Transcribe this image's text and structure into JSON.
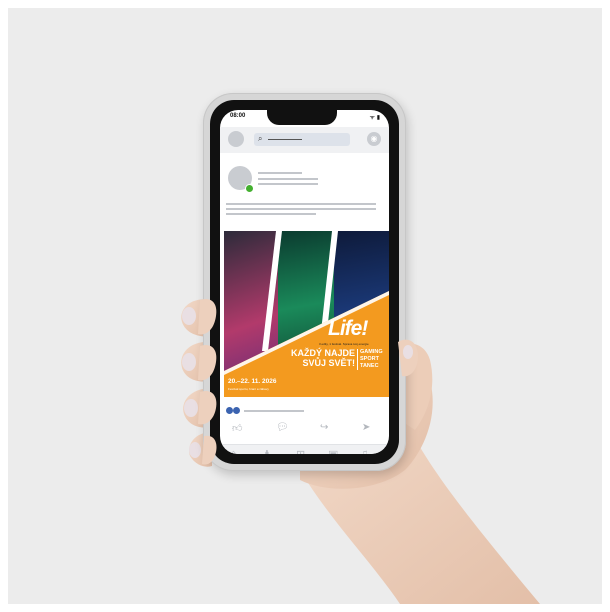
{
  "status_bar": {
    "time": "08:00",
    "icons": "ᯤ ▮"
  },
  "post": {
    "brand": "Life!",
    "tagline": "3 edity, 1 festival. Sprava tvoj energie",
    "headline_line1": "KAŽDÝ NAJDE",
    "headline_line2": "SVŮJ SVĚT!",
    "categories": [
      "GAMING",
      "SPORT",
      "TANEC"
    ],
    "date": "20.–22. 11. 2026",
    "venue": "Festival sportu, hraní a zábavy"
  },
  "icons": {
    "search": "search-icon",
    "chat": "chat-icon",
    "like": "thumbs-up-icon",
    "comment": "comment-icon",
    "share": "share-icon",
    "send": "send-icon",
    "home": "home-icon",
    "friends": "friends-icon",
    "add": "add-icon",
    "marketplace": "shop-icon",
    "notifications": "bell-icon"
  },
  "colors": {
    "accent_orange": "#f39a1f",
    "reaction_blue": "#3b63b0",
    "online_green": "#44b030"
  }
}
